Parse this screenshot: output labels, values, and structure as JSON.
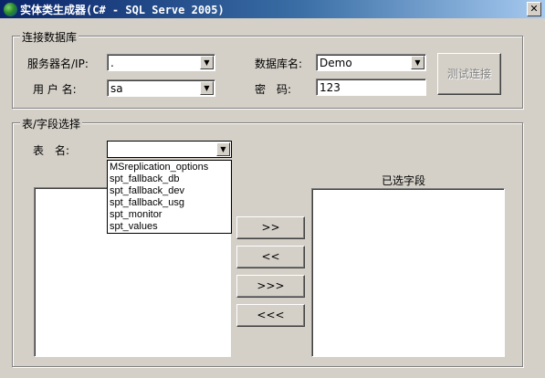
{
  "window": {
    "title": "实体类生成器(C# - SQL Serve 2005)",
    "close_glyph": "✕"
  },
  "connection": {
    "legend": "连接数据库",
    "server_label": "服务器名/IP:",
    "server_value": ".",
    "user_label": "用 户 名:",
    "user_value": "sa",
    "database_label": "数据库名:",
    "database_value": "Demo",
    "password_label": "密　码:",
    "password_value": "123",
    "test_button": "测试连接"
  },
  "fields": {
    "legend": "表/字段选择",
    "table_label": "表　名:",
    "table_value": "",
    "table_options": [
      "MSreplication_options",
      "spt_fallback_db",
      "spt_fallback_dev",
      "spt_fallback_usg",
      "spt_monitor",
      "spt_values"
    ],
    "selected_label": "已选字段",
    "btn_add": ">>",
    "btn_remove": "<<",
    "btn_add_all": ">>>",
    "btn_remove_all": "<<<"
  }
}
